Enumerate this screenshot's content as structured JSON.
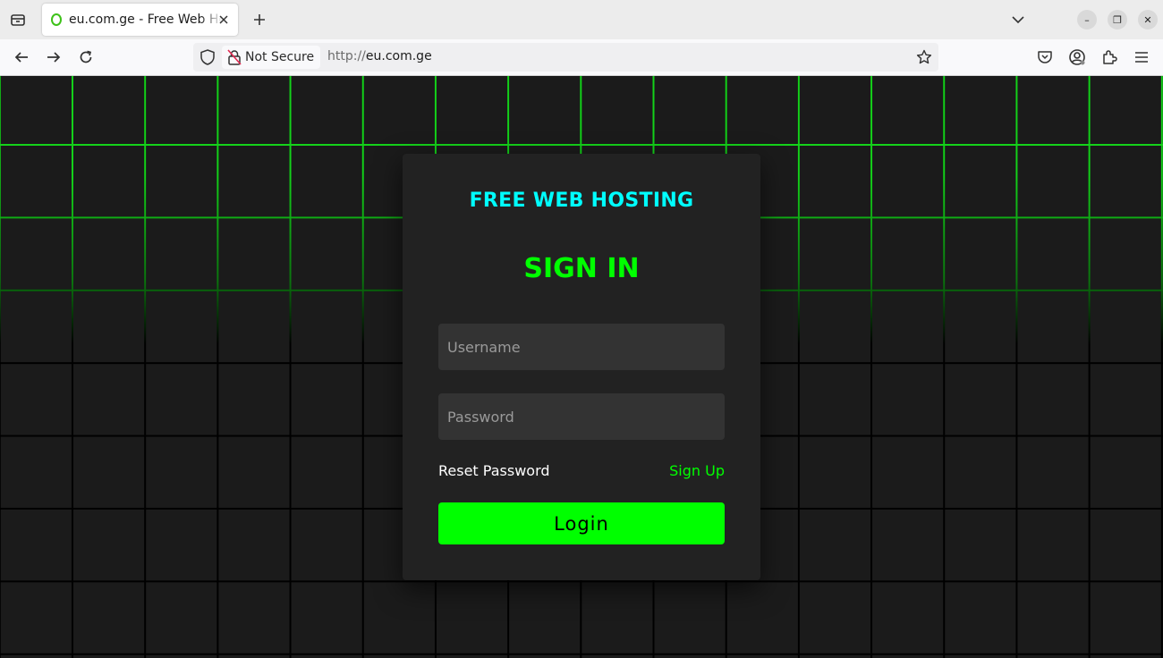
{
  "browser": {
    "tab": {
      "title": "eu.com.ge - Free Web Hosting"
    },
    "urlbar": {
      "security_label": "Not Secure",
      "url_scheme": "http://",
      "url_host": "eu.com.ge"
    },
    "window_controls": {
      "minimize": "–",
      "restore": "❐",
      "close": "✕"
    }
  },
  "login": {
    "brand": "FREE WEB HOSTING",
    "heading": "SIGN IN",
    "username_placeholder": "Username",
    "password_placeholder": "Password",
    "reset_password": "Reset Password",
    "sign_up": "Sign Up",
    "login_button": "Login"
  },
  "colors": {
    "accent_green": "#00ff00",
    "brand_cyan": "#00ffff",
    "card_background": "#222222",
    "field_background": "#333333",
    "grid_line_green": "#14d21a"
  },
  "icons": [
    "tab-list-icon",
    "favicon-icon",
    "close-icon",
    "plus-icon",
    "chevron-down-icon",
    "back-arrow-icon",
    "forward-arrow-icon",
    "reload-icon",
    "shield-icon",
    "insecure-lock-icon",
    "star-icon",
    "pocket-icon",
    "account-icon",
    "extensions-icon",
    "menu-icon"
  ]
}
